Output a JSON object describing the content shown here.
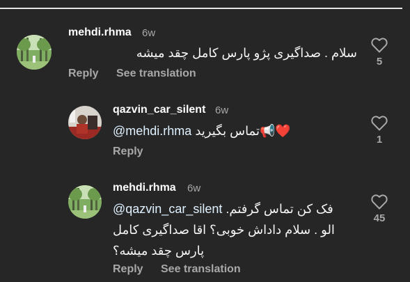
{
  "comments": [
    {
      "username": "mehdi.rhma",
      "time": "6w",
      "text": "سلام . صداگیری پژو پارس کامل چقد میشه",
      "likes": "5",
      "actions": {
        "reply": "Reply",
        "translate": "See translation"
      }
    },
    {
      "username": "qazvin_car_silent",
      "time": "6w",
      "mention": "@mehdi.rhma",
      "text": "تماس بگیرید",
      "emoji": "📢❤️",
      "likes": "1",
      "actions": {
        "reply": "Reply"
      }
    },
    {
      "username": "mehdi.rhma",
      "time": "6w",
      "mention": "@qazvin_car_silent",
      "text_line1": "فک کن تماس گرفتم.",
      "text_line2": "الو . سلام داداش خوبی؟ اقا صداگیری کامل",
      "text_line3": "پارس چقد میشه؟",
      "likes": "45",
      "actions": {
        "reply": "Reply",
        "translate": "See translation"
      }
    }
  ],
  "colors": {
    "background": "#262626",
    "muted": "#a8a8a8",
    "text": "#f5f5f5",
    "heart": "#e0245e"
  },
  "icons": {
    "like": "heart-outline-icon"
  }
}
